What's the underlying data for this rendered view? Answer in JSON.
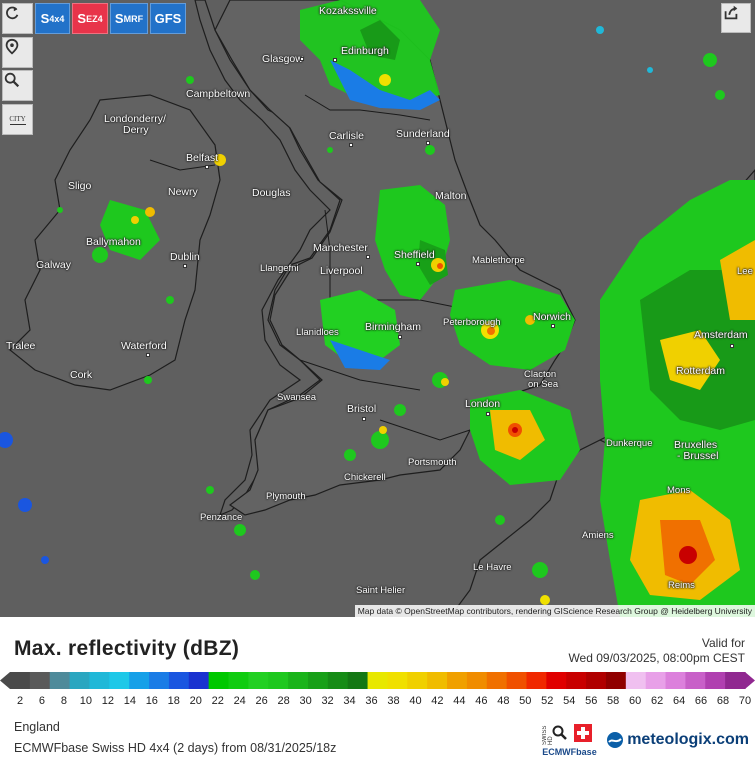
{
  "map": {
    "attribution": "Map data © OpenStreetMap contributors, rendering GIScience Research Group @ Heidelberg University",
    "controls": {
      "city_label": "CITY"
    },
    "model_buttons": [
      {
        "main": "S",
        "sub": "4x4",
        "color": "#2272c9"
      },
      {
        "main": "S",
        "sub": "EZ4",
        "color": "#e8344a"
      },
      {
        "main": "S",
        "sub": "MRF",
        "color": "#2272c9"
      },
      {
        "main": "GFS",
        "sub": "",
        "color": "#2272c9"
      }
    ],
    "cities": [
      {
        "name": "Kozakssville"
      },
      {
        "name": "Glasgow"
      },
      {
        "name": "Edinburgh"
      },
      {
        "name": "Campbeltown"
      },
      {
        "name": "Londonderry/"
      },
      {
        "name": "Derry"
      },
      {
        "name": "Carlisle"
      },
      {
        "name": "Sunderland"
      },
      {
        "name": "Belfast"
      },
      {
        "name": "Sligo"
      },
      {
        "name": "Newry"
      },
      {
        "name": "Douglas"
      },
      {
        "name": "Malton"
      },
      {
        "name": "Ballymahon"
      },
      {
        "name": "Dublin"
      },
      {
        "name": "Galway"
      },
      {
        "name": "Manchester"
      },
      {
        "name": "Sheffield"
      },
      {
        "name": "Llangefni"
      },
      {
        "name": "Liverpool"
      },
      {
        "name": "Mablethorpe"
      },
      {
        "name": "Llanidloes"
      },
      {
        "name": "Birmingham"
      },
      {
        "name": "Peterborough"
      },
      {
        "name": "Norwich"
      },
      {
        "name": "Tralee"
      },
      {
        "name": "Waterford"
      },
      {
        "name": "Cork"
      },
      {
        "name": "Clacton"
      },
      {
        "name": "on Sea"
      },
      {
        "name": "Swansea"
      },
      {
        "name": "Bristol"
      },
      {
        "name": "London"
      },
      {
        "name": "Portsmouth"
      },
      {
        "name": "Chickerell"
      },
      {
        "name": "Plymouth"
      },
      {
        "name": "Penzance"
      },
      {
        "name": "Dunkerque"
      },
      {
        "name": "Amsterdam"
      },
      {
        "name": "Rotterdam"
      },
      {
        "name": "Bruxelles"
      },
      {
        "name": "- Brussel"
      },
      {
        "name": "Mons"
      },
      {
        "name": "Amiens"
      },
      {
        "name": "Le Havre"
      },
      {
        "name": "Saint Helier"
      },
      {
        "name": "Reims"
      },
      {
        "name": "Lee"
      }
    ]
  },
  "legend": {
    "title": "Max. reflectivity (dBZ)",
    "valid_label": "Valid for",
    "valid_time": "Wed 09/03/2025, 08:00pm CEST",
    "ticks": [
      "2",
      "6",
      "8",
      "10",
      "12",
      "14",
      "16",
      "18",
      "20",
      "22",
      "24",
      "26",
      "28",
      "30",
      "32",
      "34",
      "36",
      "38",
      "40",
      "42",
      "44",
      "46",
      "48",
      "50",
      "52",
      "54",
      "56",
      "58",
      "60",
      "62",
      "64",
      "66",
      "68",
      "70"
    ],
    "colors": [
      "#4a4a4a",
      "#5a5a5a",
      "#4e8a9a",
      "#2aa6c0",
      "#20b8d8",
      "#1ec8e8",
      "#16a0e8",
      "#1a7ce6",
      "#1a56e0",
      "#1a32d0",
      "#00c800",
      "#10cc10",
      "#22d022",
      "#1ec81e",
      "#1ab41a",
      "#18a018",
      "#168c16",
      "#147814",
      "#e8e800",
      "#f0e000",
      "#f0d000",
      "#f0bc00",
      "#f0a000",
      "#f08c00",
      "#f07000",
      "#f05000",
      "#f02800",
      "#e00000",
      "#c80000",
      "#b00000",
      "#900000",
      "#f0c0f0",
      "#e8a0e8",
      "#dc80dc",
      "#c860c8",
      "#b040b0",
      "#902890"
    ]
  },
  "footer": {
    "region": "England",
    "model_line": "ECMWFbase Swiss HD 4x4 (2 days) from 08/31/2025/18z",
    "swiss_hd_text": "SWISS HD",
    "ecmwf_text": "ECMWFbase",
    "brand": "meteologix.com"
  }
}
